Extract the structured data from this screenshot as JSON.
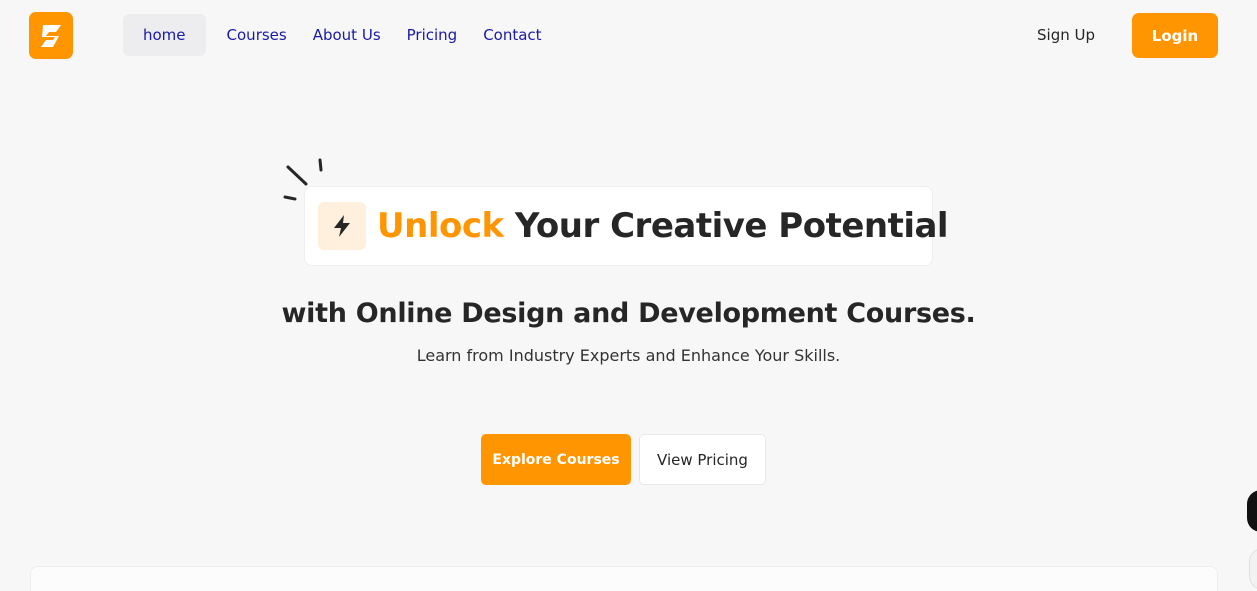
{
  "brand": {
    "logo_icon": "s-brand-icon",
    "accent_color": "#ff9500"
  },
  "nav": {
    "items": [
      {
        "label": "home",
        "active": true
      },
      {
        "label": "Courses",
        "active": false
      },
      {
        "label": "About Us",
        "active": false
      },
      {
        "label": "Pricing",
        "active": false
      },
      {
        "label": "Contact",
        "active": false
      }
    ],
    "signup_label": "Sign Up",
    "login_label": "Login"
  },
  "hero": {
    "headline_accent": "Unlock",
    "headline_rest": " Your Creative Potential",
    "headline_icon": "lightning-bolt-icon",
    "subheadline": "with Online Design and Development Courses.",
    "tagline": "Learn from Industry Experts and Enhance Your Skills.",
    "primary_button": "Explore Courses",
    "secondary_button": "View Pricing"
  }
}
